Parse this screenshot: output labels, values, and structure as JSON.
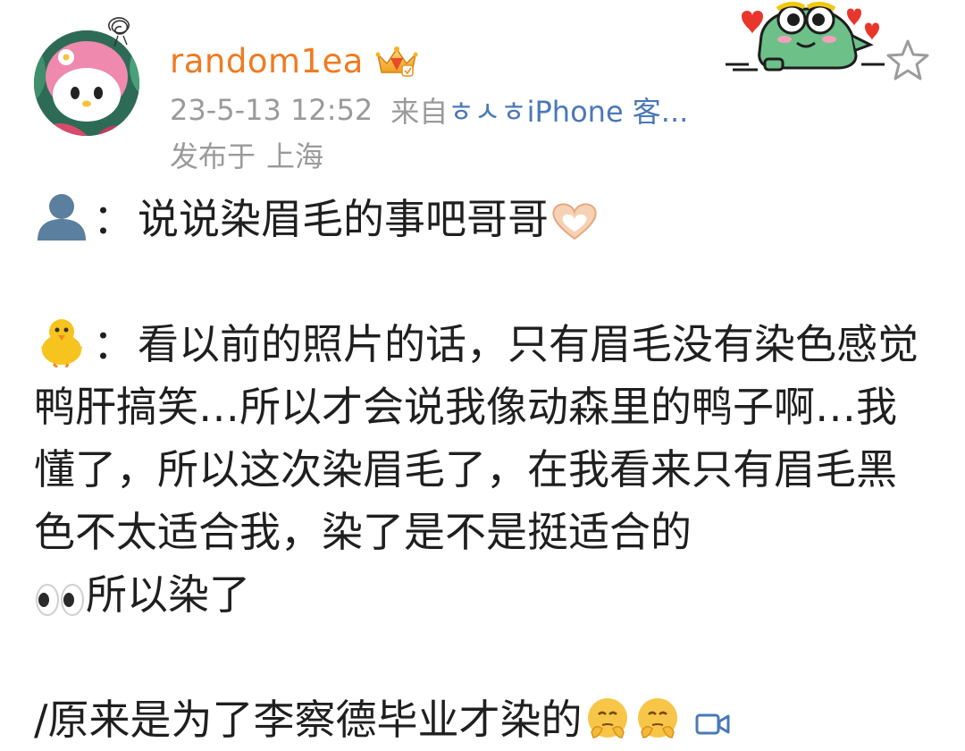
{
  "post": {
    "username": "random1ea",
    "time": "23-5-13 12:52",
    "source_prefix": "来自",
    "source_name": "ㅎㅅㅎiPhone 客...",
    "location_prefix": "发布于",
    "location": "上海"
  },
  "content": {
    "q_sep": "：",
    "question": "说说染眉毛的事吧哥哥",
    "a_sep": "：",
    "answer_1": "看以前的照片的话，只有眉毛没有染色感觉鸭肝搞笑…所以才会说我像动森里的鸭子啊…我懂了，所以这次染眉毛了，在我看来只有眉毛黑色不太适合我，染了是不是挺适合的",
    "answer_2": "所以染了",
    "note": "/原来是为了李察德毕业才染的"
  },
  "icons": {
    "question_speaker": "bust-silhouette-icon",
    "answer_speaker": "chick-icon",
    "heart_hands": "heart-hands-icon",
    "eyes": "eyes-icon",
    "shy_face": "shy-face-icon",
    "video": "video-camera-icon",
    "star": "star-outline-icon",
    "vip": "crown-badge-icon"
  },
  "colors": {
    "username": "#f07a20",
    "meta": "#9a9a9a",
    "source_link": "#4a78b8",
    "text": "#1f1f1f"
  }
}
